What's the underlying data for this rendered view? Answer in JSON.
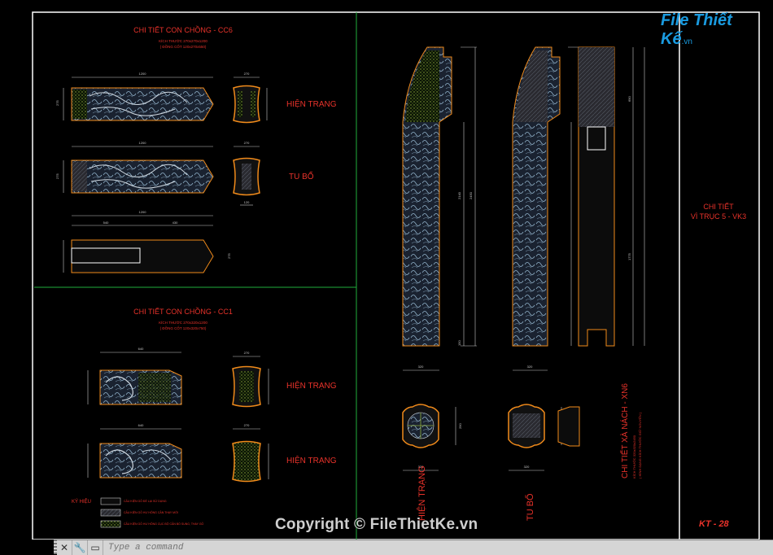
{
  "logo": {
    "brand": "File Thiết Kế",
    "domain": ".vn"
  },
  "panels": {
    "cc6": {
      "title": "CHI TIẾT CON CHỒNG - CC6",
      "sub1": "KÍCH THƯỚC 270x270x1200",
      "sub2": "( ĐỒNG CỐT 120x270x550)",
      "label_hien_trang": "HIỆN TRẠNG",
      "label_tu_bo": "TU BỔ",
      "dims": {
        "len": "1200",
        "w": "270",
        "h": "275",
        "d1": "120",
        "d2": "540",
        "d3": "430",
        "d4": "275"
      }
    },
    "cc1": {
      "title": "CHI TIẾT CON CHỒNG - CC1",
      "sub1": "KÍCH THƯỚC 270x320x1200",
      "sub2": "( ĐỒNG CỐT 120x320x750)",
      "label_hien_trang_1": "HIỆN TRẠNG",
      "label_hien_trang_2": "HIỆN TRẠNG",
      "dims": {
        "len": "640",
        "w": "270",
        "h": "320"
      }
    },
    "legend": {
      "title": "KÝ HIỆU",
      "items": [
        "CẤU KIỆN GỖ ĐỂ LẠI SỬ DỤNG",
        "CẤU KIỆN GỖ HƯ HỎNG CẦN THAY MỚI",
        "CẤU KIỆN GỖ HƯ HỎNG CỤC BỘ CẦN BỔ SUNG, THAY GỖ"
      ]
    },
    "xn6": {
      "title": "CHI TIẾT XÀ NÁCH - XN6",
      "sub1": "KÍCH THƯỚC 320x320x2450",
      "sub2": "( HÌNH DẠNG KÍCH THƯỚC GIỮ NGUYÊN )",
      "label_hien_trang": "HIỆN TRẠNG",
      "label_tu_bo": "TU BỔ",
      "dims": {
        "total": "2450",
        "top": "690",
        "mid": "2140",
        "bot": "1775",
        "base": "150",
        "w": "320",
        "h": "290"
      }
    },
    "side": {
      "line1": "CHI TIẾT",
      "line2": "VÌ TRỤC 5 - VK3",
      "sheet": "KT - 28"
    }
  },
  "watermark": "Copyright © FileThietKe.vn",
  "command": {
    "placeholder": "Type a command"
  },
  "colors": {
    "frame": "#ffffff",
    "divider": "#1fae3c",
    "text": "#e8322a",
    "outline": "#f08a1a",
    "dim": "#c9c9c9",
    "hatch": "#8fae3a"
  }
}
